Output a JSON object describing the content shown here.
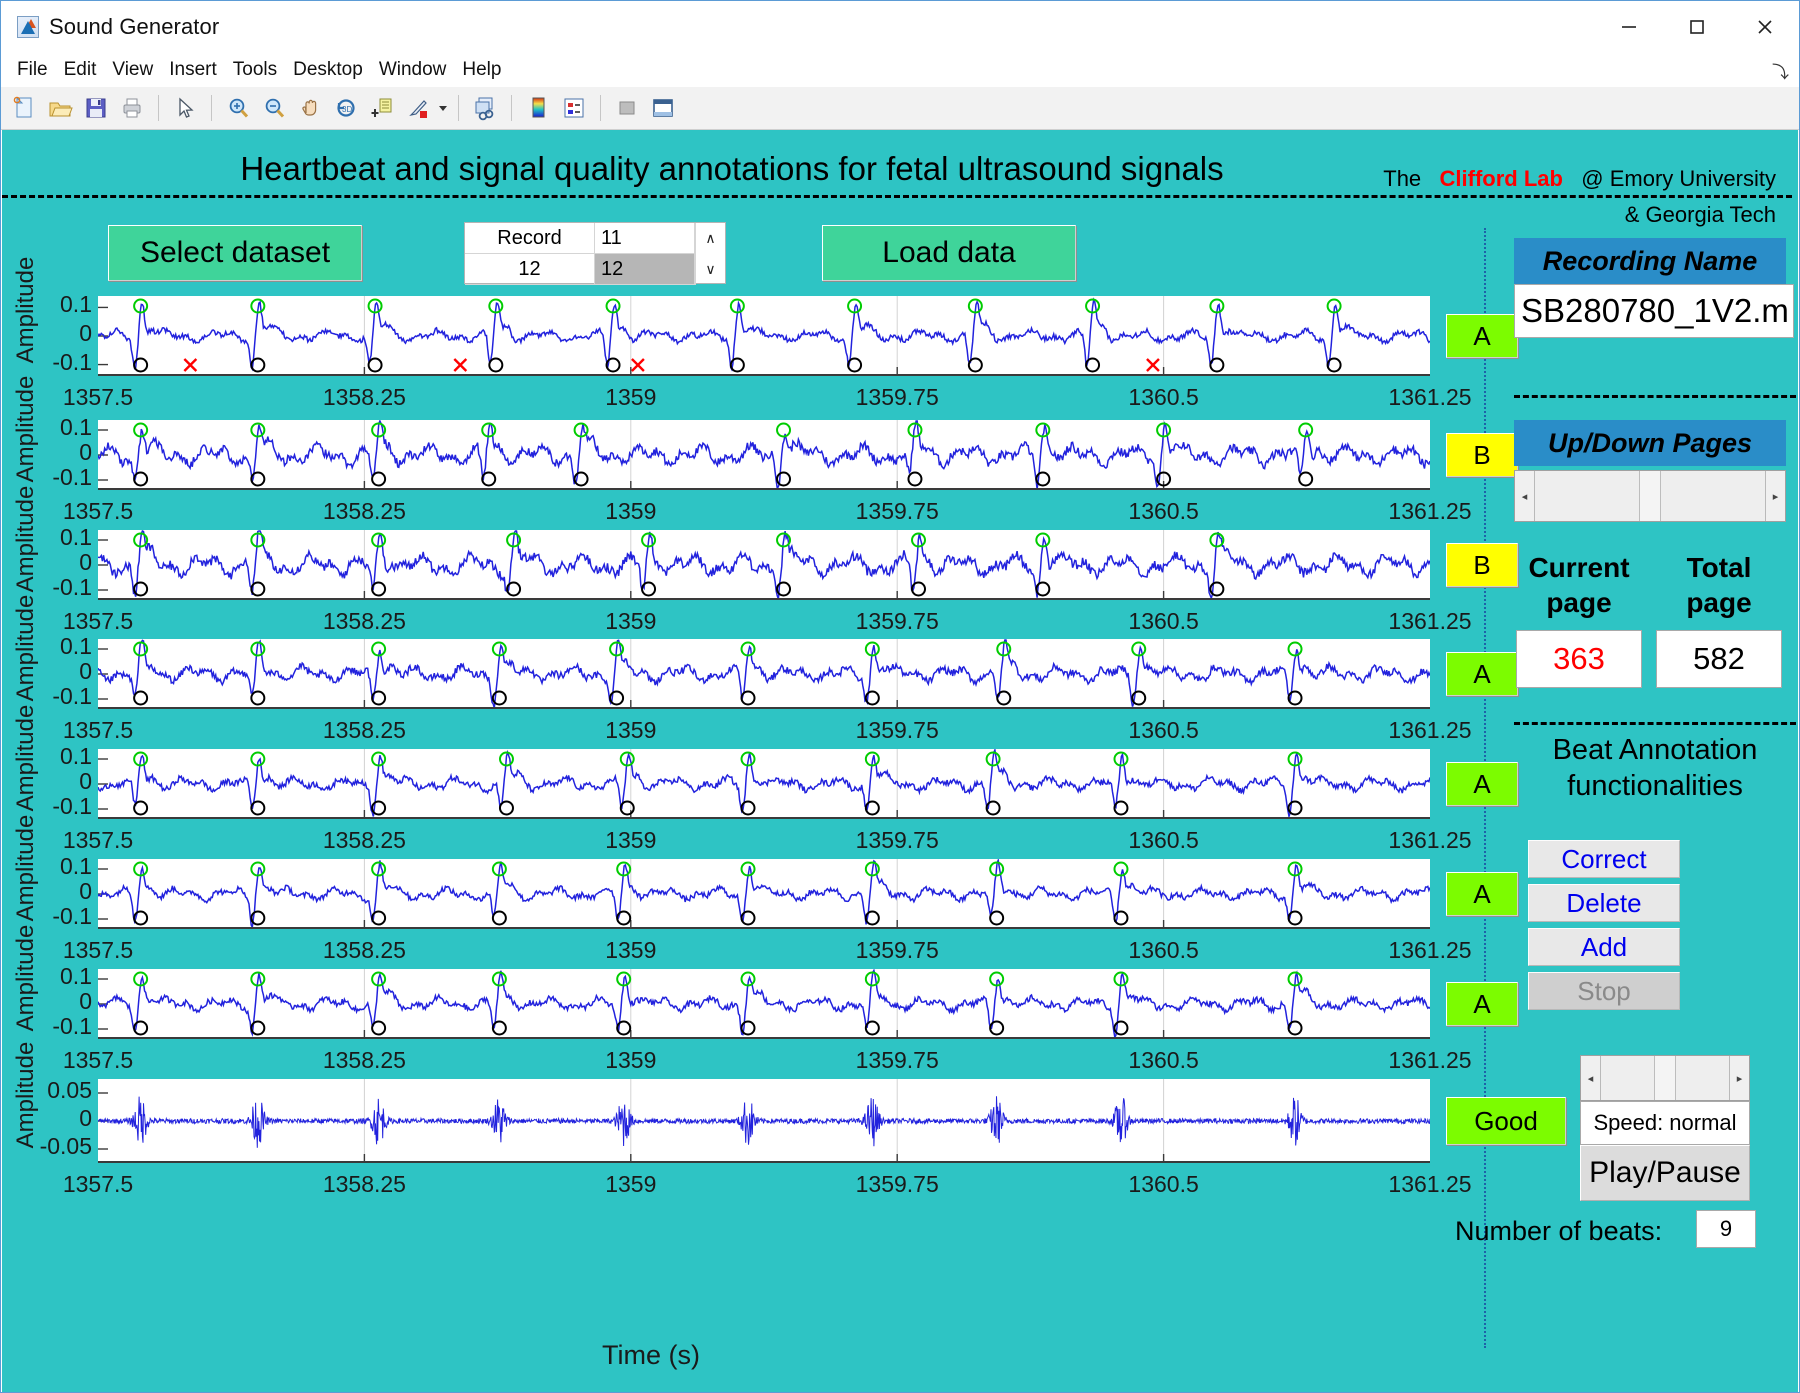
{
  "window": {
    "title": "Sound Generator",
    "app_icon": "matlab-icon",
    "minimize": "–",
    "maximize": "□",
    "close": "✕"
  },
  "menubar": {
    "items": [
      "File",
      "Edit",
      "View",
      "Insert",
      "Tools",
      "Desktop",
      "Window",
      "Help"
    ],
    "overflow": "⤵"
  },
  "toolbar": {
    "buttons": [
      "new-figure-icon",
      "open-file-icon",
      "save-figure-icon",
      "print-figure-icon",
      "pointer-icon",
      "zoom-in-icon",
      "zoom-out-icon",
      "pan-icon",
      "rotate-3d-icon",
      "data-cursor-icon",
      "brush-select-icon",
      "brush-dropdown-caret-icon",
      "link-plot-icon",
      "colorbar-icon",
      "legend-icon",
      "hide-plot-tools-icon",
      "show-plot-tools-icon"
    ]
  },
  "figure": {
    "background_color": "#2ec4c4",
    "title": "Heartbeat and signal quality annotations for fetal ultrasound signals",
    "lab_prefix": "The",
    "lab_name": "Clifford Lab",
    "lab_affiliation_1": "@ Emory University",
    "lab_affiliation_2": "& Georgia Tech",
    "lab_accent_color": "#ff0000"
  },
  "controls": {
    "select_dataset_label": "Select dataset",
    "load_data_label": "Load data",
    "record_table": {
      "header_label": "Record",
      "header_value": "11",
      "row_label": "12",
      "row_value": "12",
      "spin_up": "∧",
      "spin_down": "∨"
    }
  },
  "side_panel": {
    "recording_name_header": "Recording Name",
    "recording_name_value": "SB280780_1V2.m",
    "updown_pages_header": "Up/Down Pages",
    "current_page_label": "Current\npage",
    "current_page_label_l1": "Current",
    "current_page_label_l2": "page",
    "total_page_label_l1": "Total",
    "total_page_label_l2": "page",
    "current_page_value": "363",
    "total_page_value": "582",
    "current_page_color": "#ff0000",
    "beat_annotation_title_l1": "Beat Annotation",
    "beat_annotation_title_l2": "functionalities",
    "beat_buttons": [
      {
        "label": "Correct",
        "enabled": true
      },
      {
        "label": "Delete",
        "enabled": true
      },
      {
        "label": "Add",
        "enabled": true
      },
      {
        "label": "Stop",
        "enabled": false
      }
    ],
    "speed_label": "Speed: normal",
    "play_pause_label": "Play/Pause",
    "number_of_beats_label": "Number of beats:",
    "number_of_beats_value": "9",
    "slider_left_arrow": "◂",
    "slider_right_arrow": "▸"
  },
  "chart_data": {
    "type": "line",
    "title": "Heartbeat and signal quality annotations for fetal ultrasound signals",
    "xlabel": "Time (s)",
    "ylabel": "Amplitude",
    "xlim": [
      1357.5,
      1361.25
    ],
    "xticks": [
      "1357.5",
      "1358.25",
      "1359",
      "1359.75",
      "1360.5",
      "1361.25"
    ],
    "xtick_values": [
      1357.5,
      1358.25,
      1359,
      1359.75,
      1360.5,
      1361.25
    ],
    "grid": true,
    "trace_color": "#2222dd",
    "beat_marker_top_color": "#00cc00",
    "beat_marker_bottom_color": "#000000",
    "rejected_marker_color": "#ff0000",
    "panels": [
      {
        "index": 1,
        "ylabel": "Amplitude",
        "yticks": [
          "0.1",
          "0",
          "-0.1"
        ],
        "ytick_values": [
          0.1,
          0,
          -0.1
        ],
        "ylim": [
          -0.14,
          0.14
        ],
        "quality": "A",
        "quality_color": "#7cfc00",
        "noise": 0.022,
        "beats": [
          1357.62,
          1357.95,
          1358.28,
          1358.62,
          1358.95,
          1359.3,
          1359.63,
          1359.97,
          1360.3,
          1360.65,
          1360.98
        ],
        "rejected": [
          1357.76,
          1358.52,
          1359.02,
          1360.47
        ]
      },
      {
        "index": 2,
        "ylabel": "Amplitude",
        "yticks": [
          "0.1",
          "0",
          "-0.1"
        ],
        "ytick_values": [
          0.1,
          0,
          -0.1
        ],
        "ylim": [
          -0.14,
          0.14
        ],
        "quality": "B",
        "quality_color": "#ffff00",
        "noise": 0.042,
        "beats": [
          1357.62,
          1357.95,
          1358.29,
          1358.6,
          1358.86,
          1359.43,
          1359.8,
          1360.16,
          1360.5,
          1360.9
        ],
        "rejected": []
      },
      {
        "index": 3,
        "ylabel": "Amplitude",
        "yticks": [
          "0.1",
          "0",
          "-0.1"
        ],
        "ytick_values": [
          0.1,
          0,
          -0.1
        ],
        "ylim": [
          -0.14,
          0.14
        ],
        "quality": "B",
        "quality_color": "#ffff00",
        "noise": 0.045,
        "beats": [
          1357.62,
          1357.95,
          1358.29,
          1358.67,
          1359.05,
          1359.43,
          1359.81,
          1360.16,
          1360.65
        ],
        "rejected": []
      },
      {
        "index": 4,
        "ylabel": "Amplitude",
        "yticks": [
          "0.1",
          "0",
          "-0.1"
        ],
        "ytick_values": [
          0.1,
          0,
          -0.1
        ],
        "ylim": [
          -0.14,
          0.14
        ],
        "quality": "A",
        "quality_color": "#7cfc00",
        "noise": 0.033,
        "beats": [
          1357.62,
          1357.95,
          1358.29,
          1358.63,
          1358.96,
          1359.33,
          1359.68,
          1360.05,
          1360.43,
          1360.87
        ],
        "rejected": []
      },
      {
        "index": 5,
        "ylabel": "Amplitude",
        "yticks": [
          "0.1",
          "0",
          "-0.1"
        ],
        "ytick_values": [
          0.1,
          0,
          -0.1
        ],
        "ylim": [
          -0.14,
          0.14
        ],
        "quality": "A",
        "quality_color": "#7cfc00",
        "noise": 0.028,
        "beats": [
          1357.62,
          1357.95,
          1358.29,
          1358.65,
          1358.99,
          1359.33,
          1359.68,
          1360.02,
          1360.38,
          1360.87
        ],
        "rejected": []
      },
      {
        "index": 6,
        "ylabel": "Amplitude",
        "yticks": [
          "0.1",
          "0",
          "-0.1"
        ],
        "ytick_values": [
          0.1,
          0,
          -0.1
        ],
        "ylim": [
          -0.14,
          0.14
        ],
        "quality": "A",
        "quality_color": "#7cfc00",
        "noise": 0.026,
        "beats": [
          1357.62,
          1357.95,
          1358.29,
          1358.63,
          1358.98,
          1359.33,
          1359.68,
          1360.03,
          1360.38,
          1360.87
        ],
        "rejected": []
      },
      {
        "index": 7,
        "ylabel": "Amplitude",
        "yticks": [
          "0.1",
          "0",
          "-0.1"
        ],
        "ytick_values": [
          0.1,
          0,
          -0.1
        ],
        "ylim": [
          -0.14,
          0.14
        ],
        "quality": "A",
        "quality_color": "#7cfc00",
        "noise": 0.027,
        "beats": [
          1357.62,
          1357.95,
          1358.29,
          1358.63,
          1358.98,
          1359.33,
          1359.68,
          1360.03,
          1360.38,
          1360.87
        ],
        "rejected": []
      },
      {
        "index": 8,
        "ylabel": "Amplitude",
        "yticks": [
          "0.05",
          "0",
          "-0.05"
        ],
        "ytick_values": [
          0.05,
          0,
          -0.05
        ],
        "ylim": [
          -0.075,
          0.075
        ],
        "quality": "Good",
        "quality_color": "#7cfc00",
        "is_audio": true,
        "noise": 0.004,
        "beats": [
          1357.62,
          1357.95,
          1358.29,
          1358.63,
          1358.98,
          1359.33,
          1359.68,
          1360.03,
          1360.38,
          1360.87
        ],
        "rejected": []
      }
    ]
  }
}
